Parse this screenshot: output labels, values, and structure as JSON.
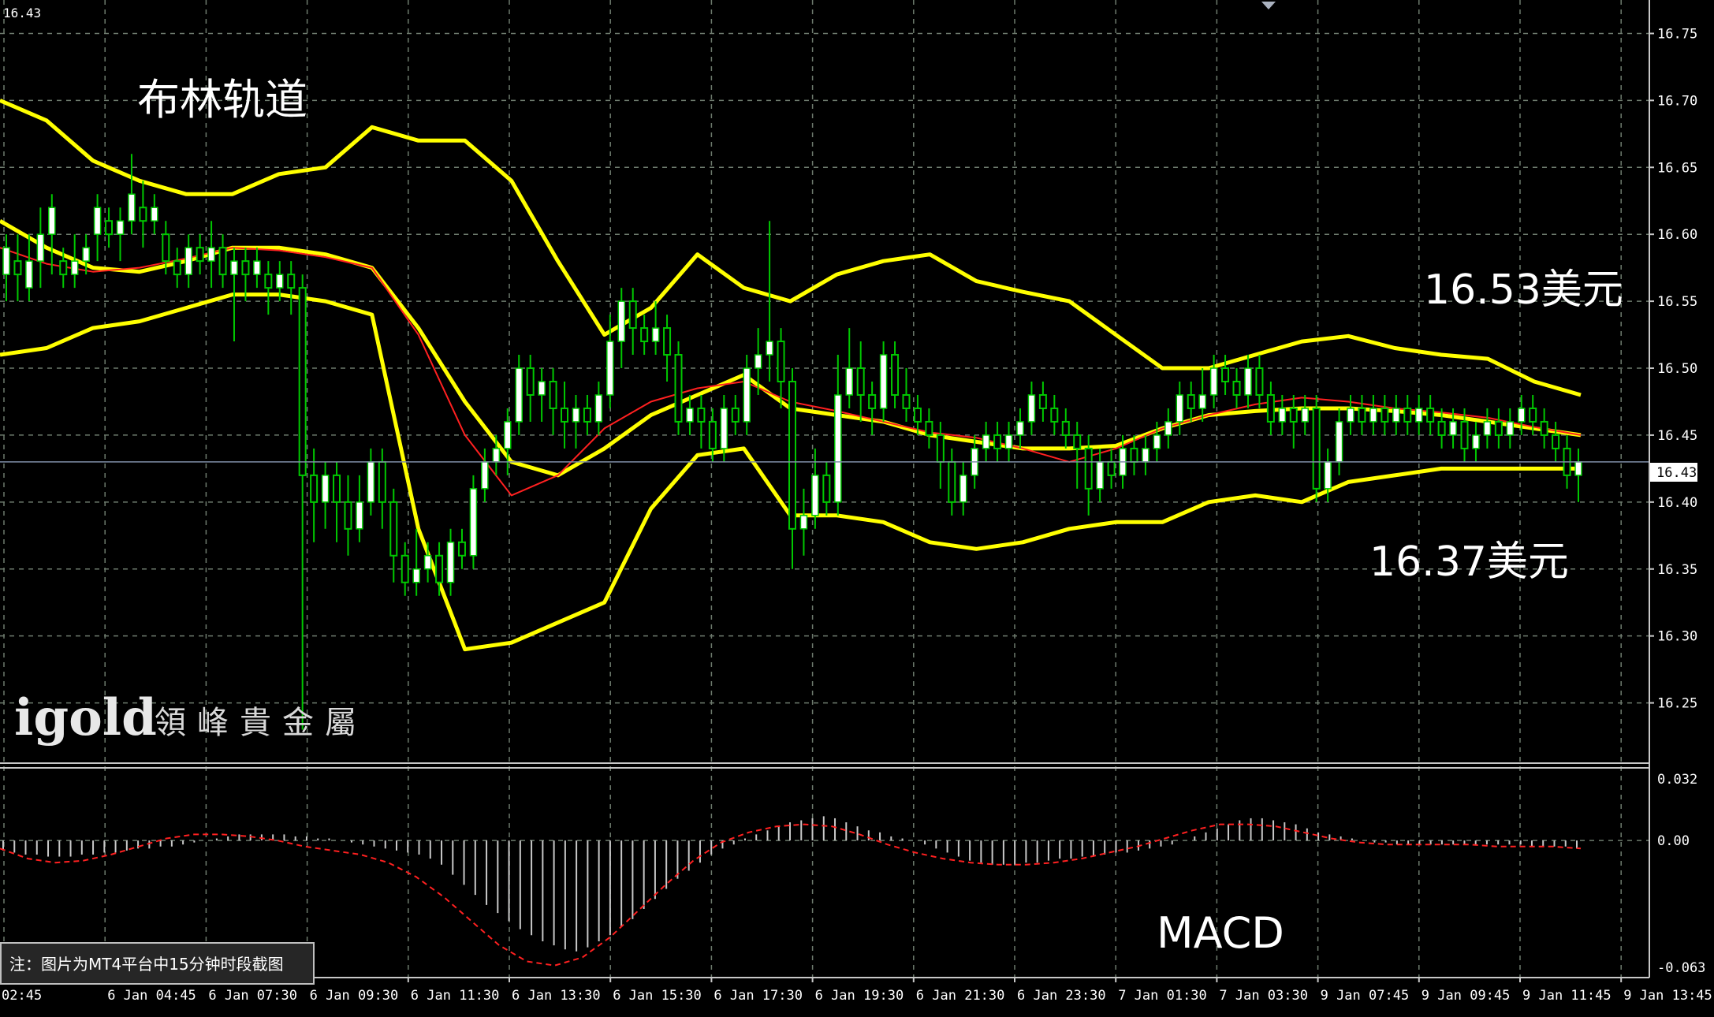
{
  "colors": {
    "background": "#000000",
    "grid": "#6e7b6e",
    "frame": "#c8c8c8",
    "bull_candle": "#ffffff",
    "wick": "#00c800",
    "bollinger": "#ffff00",
    "ma": "#ff2020",
    "macd_hist": "#c8c8c8",
    "macd_signal": "#ff2020",
    "axis_text": "#ffffff",
    "price_line": "#7f8fa8"
  },
  "chart_data": {
    "type": "candlestick",
    "instrument_price_topleft": "16.43",
    "current_price_label": "16.43",
    "annotations": {
      "title": "布林轨道",
      "upper_price": "16.53美元",
      "lower_price": "16.37美元",
      "macd_label": "MACD",
      "note": "注：图片为MT4平台中15分钟时段截图"
    },
    "logo": {
      "brand": "igold",
      "chinese": "領峰貴金屬"
    },
    "price_axis": {
      "ylim": [
        16.205,
        16.775
      ],
      "ticks": [
        "16.75",
        "16.70",
        "16.65",
        "16.60",
        "16.55",
        "16.50",
        "16.45",
        "16.40",
        "16.35",
        "16.30",
        "16.25"
      ]
    },
    "macd_axis": {
      "ylim": [
        -0.068,
        0.036
      ],
      "ticks": [
        "0.032",
        "0.00",
        "-0.063"
      ]
    },
    "time_axis": {
      "labels": [
        "02:45",
        "6 Jan 04:45",
        "6 Jan 07:30",
        "6 Jan 09:30",
        "6 Jan 11:30",
        "6 Jan 13:30",
        "6 Jan 15:30",
        "6 Jan 17:30",
        "6 Jan 19:30",
        "6 Jan 21:30",
        "6 Jan 23:30",
        "7 Jan 01:30",
        "7 Jan 03:30",
        "9 Jan 07:45",
        "9 Jan 09:45",
        "9 Jan 11:45",
        "9 Jan 13:45"
      ]
    },
    "bollinger_upper": [
      16.7,
      16.685,
      16.655,
      16.64,
      16.63,
      16.63,
      16.645,
      16.65,
      16.68,
      16.67,
      16.67,
      16.64,
      16.58,
      16.525,
      16.545,
      16.585,
      16.56,
      16.55,
      16.57,
      16.58,
      16.585,
      16.565,
      16.557,
      16.55,
      16.525,
      16.5,
      16.5,
      16.51,
      16.52,
      16.524,
      16.515,
      16.51,
      16.507,
      16.49,
      16.48
    ],
    "bollinger_mid": [
      16.61,
      16.59,
      16.575,
      16.572,
      16.58,
      16.59,
      16.59,
      16.585,
      16.575,
      16.53,
      16.475,
      16.43,
      16.42,
      16.44,
      16.465,
      16.48,
      16.495,
      16.47,
      16.465,
      16.46,
      16.45,
      16.445,
      16.44,
      16.44,
      16.442,
      16.455,
      16.465,
      16.468,
      16.47,
      16.47,
      16.468,
      16.465,
      16.46,
      16.455,
      16.45
    ],
    "bollinger_lower": [
      16.51,
      16.515,
      16.53,
      16.535,
      16.545,
      16.555,
      16.555,
      16.55,
      16.54,
      16.38,
      16.29,
      16.295,
      16.31,
      16.325,
      16.395,
      16.435,
      16.44,
      16.39,
      16.39,
      16.385,
      16.37,
      16.365,
      16.37,
      16.38,
      16.385,
      16.385,
      16.4,
      16.405,
      16.4,
      16.415,
      16.42,
      16.425,
      16.425,
      16.425,
      16.425
    ],
    "ma": [
      16.59,
      16.578,
      16.572,
      16.575,
      16.582,
      16.59,
      16.588,
      16.583,
      16.575,
      16.525,
      16.45,
      16.405,
      16.42,
      16.455,
      16.475,
      16.485,
      16.49,
      16.475,
      16.468,
      16.46,
      16.452,
      16.448,
      16.44,
      16.43,
      16.44,
      16.455,
      16.465,
      16.473,
      16.478,
      16.475,
      16.47,
      16.467,
      16.463,
      16.456,
      16.45
    ],
    "candles": [
      [
        16.57,
        16.59,
        16.55,
        16.6
      ],
      [
        16.58,
        16.57,
        16.55,
        16.6
      ],
      [
        16.56,
        16.58,
        16.55,
        16.6
      ],
      [
        16.58,
        16.6,
        16.56,
        16.62
      ],
      [
        16.6,
        16.62,
        16.57,
        16.63
      ],
      [
        16.58,
        16.57,
        16.56,
        16.59
      ],
      [
        16.57,
        16.58,
        16.56,
        16.6
      ],
      [
        16.58,
        16.59,
        16.57,
        16.6
      ],
      [
        16.6,
        16.62,
        16.58,
        16.63
      ],
      [
        16.61,
        16.6,
        16.59,
        16.62
      ],
      [
        16.6,
        16.61,
        16.58,
        16.62
      ],
      [
        16.61,
        16.63,
        16.6,
        16.66
      ],
      [
        16.62,
        16.61,
        16.59,
        16.64
      ],
      [
        16.61,
        16.62,
        16.6,
        16.63
      ],
      [
        16.6,
        16.58,
        16.57,
        16.61
      ],
      [
        16.58,
        16.57,
        16.56,
        16.59
      ],
      [
        16.57,
        16.59,
        16.56,
        16.6
      ],
      [
        16.59,
        16.58,
        16.57,
        16.6
      ],
      [
        16.58,
        16.59,
        16.56,
        16.61
      ],
      [
        16.59,
        16.57,
        16.56,
        16.6
      ],
      [
        16.57,
        16.58,
        16.52,
        16.59
      ],
      [
        16.58,
        16.57,
        16.55,
        16.59
      ],
      [
        16.57,
        16.58,
        16.56,
        16.59
      ],
      [
        16.57,
        16.56,
        16.54,
        16.58
      ],
      [
        16.56,
        16.57,
        16.55,
        16.58
      ],
      [
        16.57,
        16.56,
        16.54,
        16.58
      ],
      [
        16.56,
        16.42,
        16.23,
        16.57
      ],
      [
        16.42,
        16.4,
        16.37,
        16.44
      ],
      [
        16.4,
        16.42,
        16.38,
        16.43
      ],
      [
        16.42,
        16.4,
        16.37,
        16.43
      ],
      [
        16.4,
        16.38,
        16.36,
        16.42
      ],
      [
        16.38,
        16.4,
        16.37,
        16.42
      ],
      [
        16.4,
        16.43,
        16.39,
        16.44
      ],
      [
        16.43,
        16.4,
        16.38,
        16.44
      ],
      [
        16.4,
        16.36,
        16.34,
        16.41
      ],
      [
        16.36,
        16.34,
        16.33,
        16.37
      ],
      [
        16.34,
        16.35,
        16.33,
        16.38
      ],
      [
        16.35,
        16.36,
        16.34,
        16.37
      ],
      [
        16.36,
        16.34,
        16.33,
        16.37
      ],
      [
        16.34,
        16.37,
        16.33,
        16.38
      ],
      [
        16.37,
        16.36,
        16.35,
        16.38
      ],
      [
        16.36,
        16.41,
        16.35,
        16.42
      ],
      [
        16.41,
        16.43,
        16.4,
        16.44
      ],
      [
        16.43,
        16.44,
        16.42,
        16.45
      ],
      [
        16.44,
        16.46,
        16.42,
        16.47
      ],
      [
        16.46,
        16.5,
        16.45,
        16.51
      ],
      [
        16.5,
        16.48,
        16.46,
        16.51
      ],
      [
        16.48,
        16.49,
        16.46,
        16.5
      ],
      [
        16.49,
        16.47,
        16.45,
        16.5
      ],
      [
        16.47,
        16.46,
        16.44,
        16.49
      ],
      [
        16.46,
        16.47,
        16.44,
        16.48
      ],
      [
        16.47,
        16.46,
        16.45,
        16.48
      ],
      [
        16.46,
        16.48,
        16.45,
        16.49
      ],
      [
        16.48,
        16.52,
        16.47,
        16.54
      ],
      [
        16.52,
        16.55,
        16.5,
        16.56
      ],
      [
        16.55,
        16.53,
        16.51,
        16.56
      ],
      [
        16.53,
        16.52,
        16.51,
        16.54
      ],
      [
        16.52,
        16.53,
        16.51,
        16.55
      ],
      [
        16.53,
        16.51,
        16.49,
        16.54
      ],
      [
        16.51,
        16.46,
        16.45,
        16.52
      ],
      [
        16.46,
        16.47,
        16.45,
        16.48
      ],
      [
        16.47,
        16.46,
        16.44,
        16.48
      ],
      [
        16.46,
        16.44,
        16.43,
        16.47
      ],
      [
        16.44,
        16.47,
        16.43,
        16.48
      ],
      [
        16.47,
        16.46,
        16.45,
        16.48
      ],
      [
        16.46,
        16.5,
        16.45,
        16.51
      ],
      [
        16.5,
        16.51,
        16.48,
        16.53
      ],
      [
        16.51,
        16.52,
        16.49,
        16.61
      ],
      [
        16.52,
        16.49,
        16.47,
        16.53
      ],
      [
        16.49,
        16.38,
        16.35,
        16.5
      ],
      [
        16.38,
        16.39,
        16.36,
        16.41
      ],
      [
        16.39,
        16.42,
        16.38,
        16.44
      ],
      [
        16.42,
        16.4,
        16.39,
        16.43
      ],
      [
        16.4,
        16.48,
        16.39,
        16.51
      ],
      [
        16.48,
        16.5,
        16.47,
        16.53
      ],
      [
        16.5,
        16.48,
        16.46,
        16.52
      ],
      [
        16.48,
        16.47,
        16.45,
        16.49
      ],
      [
        16.47,
        16.51,
        16.46,
        16.52
      ],
      [
        16.51,
        16.48,
        16.47,
        16.52
      ],
      [
        16.48,
        16.47,
        16.46,
        16.5
      ],
      [
        16.47,
        16.46,
        16.45,
        16.48
      ],
      [
        16.46,
        16.45,
        16.44,
        16.47
      ],
      [
        16.45,
        16.43,
        16.41,
        16.46
      ],
      [
        16.43,
        16.4,
        16.39,
        16.44
      ],
      [
        16.4,
        16.42,
        16.39,
        16.43
      ],
      [
        16.42,
        16.44,
        16.41,
        16.45
      ],
      [
        16.44,
        16.45,
        16.43,
        16.46
      ],
      [
        16.45,
        16.44,
        16.43,
        16.46
      ],
      [
        16.44,
        16.45,
        16.43,
        16.46
      ],
      [
        16.45,
        16.46,
        16.44,
        16.47
      ],
      [
        16.46,
        16.48,
        16.45,
        16.49
      ],
      [
        16.48,
        16.47,
        16.46,
        16.49
      ],
      [
        16.47,
        16.46,
        16.45,
        16.48
      ],
      [
        16.46,
        16.45,
        16.44,
        16.47
      ],
      [
        16.45,
        16.44,
        16.41,
        16.46
      ],
      [
        16.44,
        16.41,
        16.39,
        16.45
      ],
      [
        16.41,
        16.43,
        16.4,
        16.44
      ],
      [
        16.43,
        16.42,
        16.41,
        16.44
      ],
      [
        16.42,
        16.44,
        16.41,
        16.45
      ],
      [
        16.44,
        16.43,
        16.42,
        16.45
      ],
      [
        16.43,
        16.44,
        16.42,
        16.45
      ],
      [
        16.44,
        16.45,
        16.43,
        16.46
      ],
      [
        16.45,
        16.46,
        16.44,
        16.47
      ],
      [
        16.46,
        16.48,
        16.45,
        16.49
      ],
      [
        16.48,
        16.47,
        16.46,
        16.49
      ],
      [
        16.47,
        16.48,
        16.46,
        16.5
      ],
      [
        16.48,
        16.5,
        16.47,
        16.51
      ],
      [
        16.5,
        16.49,
        16.48,
        16.51
      ],
      [
        16.49,
        16.48,
        16.47,
        16.5
      ],
      [
        16.48,
        16.5,
        16.47,
        16.51
      ],
      [
        16.5,
        16.48,
        16.47,
        16.51
      ],
      [
        16.48,
        16.46,
        16.45,
        16.49
      ],
      [
        16.46,
        16.47,
        16.45,
        16.48
      ],
      [
        16.47,
        16.46,
        16.44,
        16.48
      ],
      [
        16.46,
        16.47,
        16.45,
        16.48
      ],
      [
        16.47,
        16.41,
        16.4,
        16.48
      ],
      [
        16.41,
        16.43,
        16.4,
        16.44
      ],
      [
        16.43,
        16.46,
        16.42,
        16.47
      ],
      [
        16.46,
        16.47,
        16.45,
        16.48
      ],
      [
        16.47,
        16.46,
        16.45,
        16.48
      ],
      [
        16.46,
        16.47,
        16.45,
        16.48
      ],
      [
        16.47,
        16.46,
        16.45,
        16.48
      ],
      [
        16.46,
        16.47,
        16.45,
        16.48
      ],
      [
        16.47,
        16.46,
        16.45,
        16.48
      ],
      [
        16.46,
        16.47,
        16.45,
        16.48
      ],
      [
        16.47,
        16.46,
        16.45,
        16.48
      ],
      [
        16.46,
        16.45,
        16.44,
        16.47
      ],
      [
        16.45,
        16.46,
        16.44,
        16.47
      ],
      [
        16.46,
        16.44,
        16.43,
        16.47
      ],
      [
        16.44,
        16.45,
        16.43,
        16.46
      ],
      [
        16.45,
        16.46,
        16.44,
        16.47
      ],
      [
        16.46,
        16.45,
        16.44,
        16.47
      ],
      [
        16.45,
        16.46,
        16.44,
        16.47
      ],
      [
        16.46,
        16.47,
        16.45,
        16.48
      ],
      [
        16.47,
        16.46,
        16.45,
        16.48
      ],
      [
        16.46,
        16.45,
        16.44,
        16.47
      ],
      [
        16.45,
        16.44,
        16.43,
        16.46
      ],
      [
        16.44,
        16.42,
        16.41,
        16.45
      ],
      [
        16.42,
        16.43,
        16.4,
        16.44
      ]
    ],
    "macd_histogram": [
      -0.005,
      -0.006,
      -0.007,
      -0.007,
      -0.008,
      -0.008,
      -0.008,
      -0.007,
      -0.007,
      -0.006,
      -0.006,
      -0.005,
      -0.004,
      -0.004,
      -0.003,
      -0.003,
      -0.002,
      -0.001,
      0.0,
      0.001,
      0.002,
      0.003,
      0.003,
      0.003,
      0.003,
      0.003,
      0.002,
      0.002,
      0.001,
      0.001,
      0.0,
      -0.001,
      -0.002,
      -0.003,
      -0.004,
      -0.005,
      -0.006,
      -0.007,
      -0.009,
      -0.012,
      -0.017,
      -0.022,
      -0.027,
      -0.032,
      -0.036,
      -0.04,
      -0.044,
      -0.047,
      -0.05,
      -0.052,
      -0.054,
      -0.055,
      -0.053,
      -0.05,
      -0.047,
      -0.043,
      -0.039,
      -0.034,
      -0.029,
      -0.024,
      -0.019,
      -0.015,
      -0.011,
      -0.007,
      -0.004,
      -0.002,
      0.001,
      0.003,
      0.005,
      0.007,
      0.009,
      0.01,
      0.011,
      0.012,
      0.011,
      0.009,
      0.007,
      0.005,
      0.004,
      0.002,
      0.001,
      0.0,
      -0.002,
      -0.004,
      -0.006,
      -0.008,
      -0.01,
      -0.011,
      -0.012,
      -0.012,
      -0.012,
      -0.011,
      -0.011,
      -0.01,
      -0.009,
      -0.009,
      -0.008,
      -0.008,
      -0.007,
      -0.006,
      -0.006,
      -0.005,
      -0.004,
      -0.003,
      -0.002,
      0.0,
      0.002,
      0.004,
      0.006,
      0.008,
      0.01,
      0.011,
      0.011,
      0.01,
      0.009,
      0.008,
      0.006,
      0.004,
      0.003,
      0.002,
      0.001,
      0.0,
      -0.001,
      -0.001,
      -0.002,
      -0.002,
      -0.002,
      -0.002,
      -0.002,
      -0.002,
      -0.002,
      -0.002,
      -0.002,
      -0.002,
      -0.002,
      -0.002,
      -0.003,
      -0.003,
      -0.003,
      -0.003,
      -0.004
    ],
    "macd_signal": [
      -0.004,
      -0.009,
      -0.011,
      -0.01,
      -0.007,
      -0.003,
      0.001,
      0.003,
      0.003,
      0.002,
      0.0,
      -0.003,
      -0.005,
      -0.007,
      -0.011,
      -0.018,
      -0.028,
      -0.04,
      -0.052,
      -0.06,
      -0.062,
      -0.058,
      -0.048,
      -0.035,
      -0.022,
      -0.01,
      -0.001,
      0.004,
      0.007,
      0.008,
      0.007,
      0.003,
      -0.002,
      -0.006,
      -0.009,
      -0.011,
      -0.012,
      -0.012,
      -0.011,
      -0.009,
      -0.006,
      -0.003,
      0.001,
      0.005,
      0.008,
      0.008,
      0.007,
      0.004,
      0.001,
      -0.001,
      -0.002,
      -0.002,
      -0.002,
      -0.002,
      -0.003,
      -0.003,
      -0.003,
      -0.004
    ]
  }
}
